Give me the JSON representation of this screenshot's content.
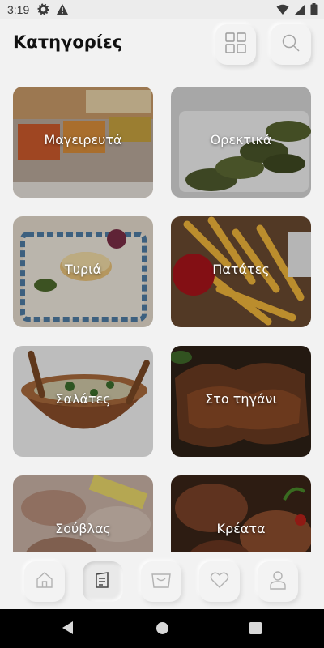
{
  "status_bar": {
    "time": "3:19",
    "left_icons": [
      "gear-icon",
      "warning-icon"
    ],
    "right_icons": [
      "wifi-icon",
      "signal-icon",
      "battery-icon"
    ]
  },
  "header": {
    "title": "Κατηγορίες",
    "buttons": [
      "grid-view-icon",
      "search-icon"
    ]
  },
  "categories": [
    {
      "label": "Μαγειρευτά"
    },
    {
      "label": "Ορεκτικά"
    },
    {
      "label": "Τυριά"
    },
    {
      "label": "Πατάτες"
    },
    {
      "label": "Σαλάτες"
    },
    {
      "label": "Στο τηγάνι"
    },
    {
      "label": "Σούβλας"
    },
    {
      "label": "Κρέατα"
    }
  ],
  "bottom_nav": {
    "items": [
      "home-icon",
      "menu-icon",
      "basket-icon",
      "heart-icon",
      "user-icon"
    ],
    "active": "menu-icon"
  },
  "system_nav": [
    "back-icon",
    "home-circle-icon",
    "recents-icon"
  ],
  "colors": {
    "background": "#f2f2f2",
    "title": "#111111",
    "system_bar": "#000000"
  }
}
